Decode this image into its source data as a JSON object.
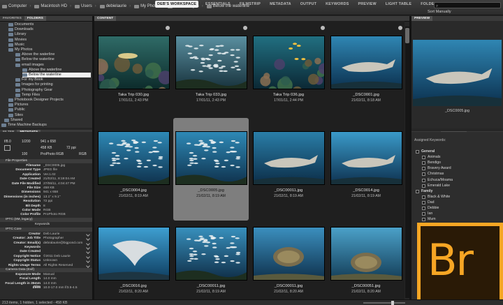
{
  "path_bar": {
    "crumbs": [
      "Computer",
      "Macintosh HD",
      "Users",
      "debielaurie",
      "My Photos",
      "email images",
      "Below the waterline"
    ]
  },
  "workspaces": [
    {
      "label": "DEB'S WORKSPACE",
      "active": true
    },
    {
      "label": "ESSENTIALS",
      "active": false
    },
    {
      "label": "FILMSTRIP",
      "active": false
    },
    {
      "label": "METADATA",
      "active": false
    },
    {
      "label": "OUTPUT",
      "active": false
    },
    {
      "label": "KEYWORDS",
      "active": false
    },
    {
      "label": "PREVIEW",
      "active": false
    },
    {
      "label": "LIGHT TABLE",
      "active": false
    },
    {
      "label": "FOLDERS",
      "active": false
    }
  ],
  "sort_label": "Sort Manually",
  "left_top_tabs": [
    "FAVORITES",
    "FOLDERS"
  ],
  "folder_tree": [
    {
      "label": "Documents",
      "indent": 0
    },
    {
      "label": "Downloads",
      "indent": 0
    },
    {
      "label": "Library",
      "indent": 0
    },
    {
      "label": "Movies",
      "indent": 0
    },
    {
      "label": "Music",
      "indent": 0
    },
    {
      "label": "My Photos",
      "indent": 0
    },
    {
      "label": "Above the waterline",
      "indent": 1
    },
    {
      "label": "Below the waterline",
      "indent": 1
    },
    {
      "label": "email images",
      "indent": 1
    },
    {
      "label": "Above the waterline",
      "indent": 2
    },
    {
      "label": "Below the waterline",
      "indent": 2,
      "selected": true
    },
    {
      "label": "For my Book",
      "indent": 1
    },
    {
      "label": "Images for printing",
      "indent": 1
    },
    {
      "label": "Photography Gear",
      "indent": 1
    },
    {
      "label": "Temp Files",
      "indent": 1
    },
    {
      "label": "Photobook Designer Projects",
      "indent": 0
    },
    {
      "label": "Pictures",
      "indent": 0
    },
    {
      "label": "Public",
      "indent": 0
    },
    {
      "label": "Sites",
      "indent": 0
    },
    {
      "label": "Shared",
      "indent": -1
    },
    {
      "label": "Time Machine Backups",
      "indent": -2
    }
  ],
  "meta_tabs": [
    "FILTER",
    "METADATA"
  ],
  "quick_info": {
    "fstop": "f/8.0",
    "shutter": "1/200",
    "iso": "100",
    "dims": "941 x 658",
    "size": "458 KB",
    "ppi": "72 ppi",
    "profile": "ProPhoto RGB",
    "mode": "RGB"
  },
  "file_properties": {
    "title": "File Properties",
    "rows": [
      [
        "Filename",
        "_DSC0005.jpg"
      ],
      [
        "Document Type",
        "JPEG file"
      ],
      [
        "Application",
        "Ver.1.02"
      ],
      [
        "Date Created",
        "21/02/11, 8:19:04 AM"
      ],
      [
        "Date File Modified",
        "27/06/11, 4:04:47 PM"
      ],
      [
        "File Size",
        "458 KB"
      ],
      [
        "Dimensions",
        "941 x 658"
      ],
      [
        "Dimensions (in inches)",
        "13.1\" x 9.1\""
      ],
      [
        "Resolution",
        "72 ppi"
      ],
      [
        "Bit Depth",
        "8"
      ],
      [
        "Color Mode",
        "RGB"
      ],
      [
        "Color Profile",
        "ProPhoto RGB"
      ]
    ]
  },
  "iptc_legacy_title": "IPTC (IIM, legacy)",
  "keywords_label": "Keywords",
  "iptc_core": {
    "title": "IPTC Core",
    "rows": [
      [
        "Creator",
        "Deb Laurie"
      ],
      [
        "Creator: Job Title",
        "Photographer"
      ],
      [
        "Creator: Email(s)",
        "debralaurie@bigpond.com"
      ],
      [
        "Keywords",
        ""
      ],
      [
        "Date Created",
        ""
      ],
      [
        "Copyright Notice",
        "©2011 Deb Laurie"
      ],
      [
        "Copyright Status",
        "Unknown"
      ],
      [
        "Rights Usage Terms",
        "All Rights Reserved"
      ]
    ]
  },
  "camera_data": {
    "title": "Camera Data (Exif)",
    "rows": [
      [
        "Exposure Mode",
        "Manual"
      ],
      [
        "Focal Length",
        "14.0 mm"
      ],
      [
        "Focal Length in 35mm Film",
        "14.0 mm"
      ],
      [
        "Lens",
        "10.0-17.0 mm f/3.5-4.5"
      ]
    ]
  },
  "content_tab": "CONTENT",
  "thumbnails": [
    {
      "name": "Taka Trip 030.jpg",
      "date": "17/01/11, 2:43 PM",
      "scene": "reef"
    },
    {
      "name": "Taka Trip 033.jpg",
      "date": "17/01/11, 2:43 PM",
      "scene": "school"
    },
    {
      "name": "Taka Trip 036.jpg",
      "date": "17/01/11, 2:44 PM",
      "scene": "reef2"
    },
    {
      "name": "_DSC0001.jpg",
      "date": "21/02/11, 8:18 AM",
      "scene": "shark"
    },
    {
      "name": "_DSC0004.jpg",
      "date": "21/02/11, 8:19 AM",
      "scene": "school2"
    },
    {
      "name": "_DSC0005.jpg",
      "date": "21/02/11, 8:19 AM",
      "scene": "school2",
      "selected": true
    },
    {
      "name": "_DSC00011.jpg",
      "date": "21/02/11, 8:19 AM",
      "scene": "shark2"
    },
    {
      "name": "_DSC0014.jpg",
      "date": "21/02/11, 8:19 AM",
      "scene": "shark3"
    },
    {
      "name": "_DSC0016.jpg",
      "date": "21/02/11, 8:20 AM",
      "scene": "ray"
    },
    {
      "name": "_DSC00011.jpg",
      "date": "21/02/11, 8:19 AM",
      "scene": "school3"
    },
    {
      "name": "_DSC00011.jpg",
      "date": "21/02/11, 8:20 AM",
      "scene": "turtle"
    },
    {
      "name": "_DSC00051.jpg",
      "date": "21/02/11, 8:20 AM",
      "scene": "turtle2"
    }
  ],
  "preview_tab": "PREVIEW",
  "preview_name": "_DSC0005.jpg",
  "right_bottom_tabs": [
    "COLLECTIONS",
    "KEYWORDS"
  ],
  "assigned_keywords_label": "Assigned Keywords:",
  "keywords": [
    {
      "label": "General",
      "group": true
    },
    {
      "label": "Animals"
    },
    {
      "label": "Bendigo"
    },
    {
      "label": "Bravery Award"
    },
    {
      "label": "Christmas"
    },
    {
      "label": "Echuca/Moama"
    },
    {
      "label": "Emerald Lake"
    },
    {
      "label": "Family",
      "group": true
    },
    {
      "label": "Black & White"
    },
    {
      "label": "Dad"
    },
    {
      "label": "Debbie"
    },
    {
      "label": "Ian"
    },
    {
      "label": "Mum"
    },
    {
      "label": "Rob"
    }
  ],
  "logo_text": "Br",
  "status_text": "213 items, 1 hidden, 1 selected - 458 KB",
  "colors": {
    "selection": "#7e7e7e",
    "logo": "#f7a624",
    "active_tab": "#f0f0f0"
  }
}
